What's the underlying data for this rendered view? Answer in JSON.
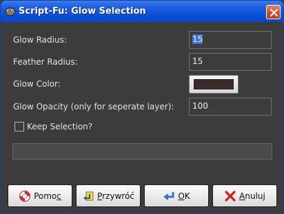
{
  "window": {
    "title": "Script-Fu: Glow Selection",
    "icons": {
      "app": "gimp-wilber-icon",
      "close": "close-x-icon"
    }
  },
  "form": {
    "glow_radius": {
      "label": "Glow Radius:",
      "value": "15"
    },
    "feather_radius": {
      "label": "Feather Radius:",
      "value": "15"
    },
    "glow_color": {
      "label": "Glow Color:",
      "color": "#3b2a2a"
    },
    "glow_opacity": {
      "label": "Glow Opacity (only for seperate layer):",
      "value": "100"
    },
    "keep_selection": {
      "label": "Keep Selection?",
      "checked": false
    }
  },
  "progress": {
    "fraction": 0
  },
  "buttons": {
    "help": {
      "pre": "Pomo",
      "mnemonic": "c",
      "post": "",
      "icon": "lifebuoy-icon"
    },
    "reset": {
      "pre": "",
      "mnemonic": "P",
      "post": "rzywróć",
      "icon": "undo-arrow-icon"
    },
    "ok": {
      "pre": "",
      "mnemonic": "O",
      "post": "K",
      "icon": "ok-arrow-icon"
    },
    "cancel": {
      "pre": "",
      "mnemonic": "A",
      "post": "nuluj",
      "icon": "red-x-icon"
    }
  },
  "colors": {
    "titlebar": "#0b4fd6",
    "background": "#3c3c3c",
    "selection": "#3f6fd8"
  }
}
